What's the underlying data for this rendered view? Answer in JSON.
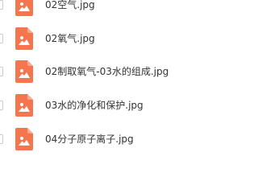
{
  "files": [
    {
      "name": "02空气.jpg",
      "icon": "image-file-icon"
    },
    {
      "name": "02氧气.jpg",
      "icon": "image-file-icon"
    },
    {
      "name": "02制取氧气-03水的组成.jpg",
      "icon": "image-file-icon"
    },
    {
      "name": "03水的净化和保护.jpg",
      "icon": "image-file-icon"
    },
    {
      "name": "04分子原子离子.jpg",
      "icon": "image-file-icon"
    }
  ],
  "colors": {
    "icon_fill": "#f5754f",
    "icon_fold": "#f9a98f",
    "text": "#333333"
  }
}
